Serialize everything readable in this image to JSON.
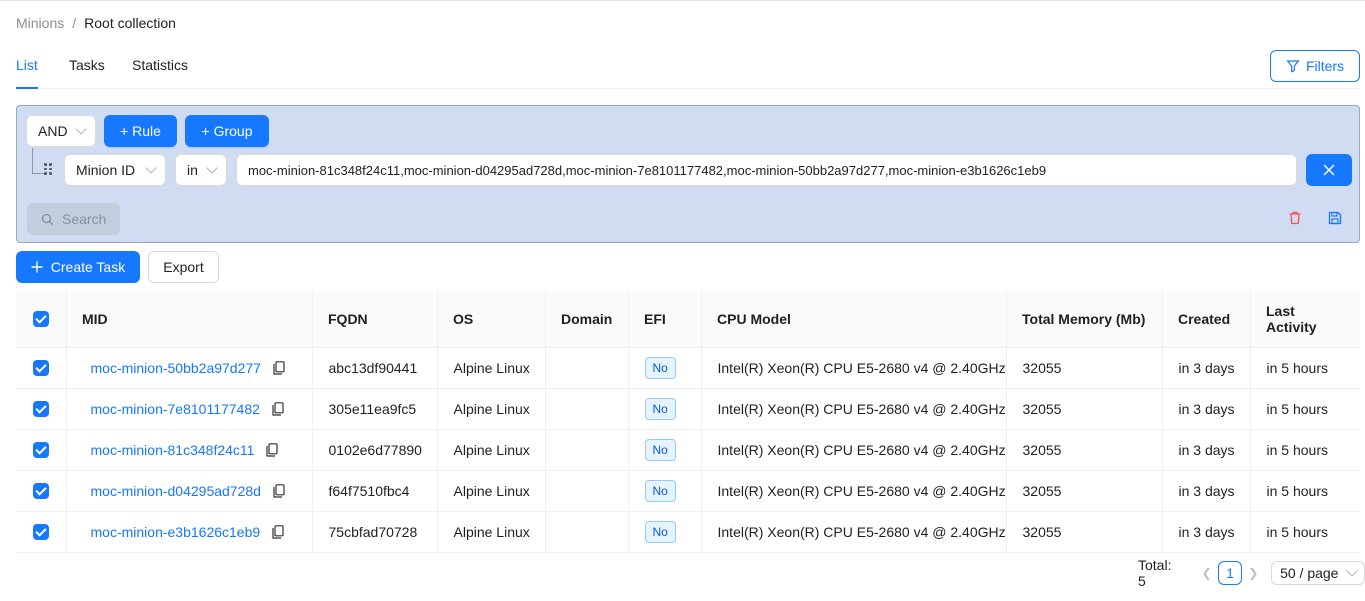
{
  "breadcrumb": {
    "parent": "Minions",
    "separator": "/",
    "current": "Root collection"
  },
  "tabs": [
    {
      "label": "List",
      "active": true
    },
    {
      "label": "Tasks",
      "active": false
    },
    {
      "label": "Statistics",
      "active": false
    }
  ],
  "filters_label": "Filters",
  "query": {
    "combinator": "AND",
    "add_rule_label": "+ Rule",
    "add_group_label": "+ Group",
    "rule": {
      "field": "Minion ID",
      "operator": "in",
      "value": "moc-minion-81c348f24c11,moc-minion-d04295ad728d,moc-minion-7e8101177482,moc-minion-50bb2a97d277,moc-minion-e3b1626c1eb9"
    },
    "search_label": "Search",
    "colors": {
      "panel_bg": "#d0dcf2",
      "delete": "#ff4d4f",
      "save": "#1677ff"
    }
  },
  "actions": {
    "create_task": "Create Task",
    "export": "Export"
  },
  "table": {
    "columns": [
      "MID",
      "FQDN",
      "OS",
      "Domain",
      "EFI",
      "CPU Model",
      "Total Memory (Mb)",
      "Created",
      "Last Activity"
    ],
    "rows": [
      {
        "mid": "moc-minion-50bb2a97d277",
        "fqdn": "abc13df90441",
        "os": "Alpine Linux",
        "domain": "",
        "efi": "No",
        "cpu": "Intel(R) Xeon(R) CPU E5-2680 v4 @ 2.40GHz",
        "memory": "32055",
        "created": "in 3 days",
        "last_activity": "in 5 hours",
        "checked": true
      },
      {
        "mid": "moc-minion-7e8101177482",
        "fqdn": "305e11ea9fc5",
        "os": "Alpine Linux",
        "domain": "",
        "efi": "No",
        "cpu": "Intel(R) Xeon(R) CPU E5-2680 v4 @ 2.40GHz",
        "memory": "32055",
        "created": "in 3 days",
        "last_activity": "in 5 hours",
        "checked": true
      },
      {
        "mid": "moc-minion-81c348f24c11",
        "fqdn": "0102e6d77890",
        "os": "Alpine Linux",
        "domain": "",
        "efi": "No",
        "cpu": "Intel(R) Xeon(R) CPU E5-2680 v4 @ 2.40GHz",
        "memory": "32055",
        "created": "in 3 days",
        "last_activity": "in 5 hours",
        "checked": true
      },
      {
        "mid": "moc-minion-d04295ad728d",
        "fqdn": "f64f7510fbc4",
        "os": "Alpine Linux",
        "domain": "",
        "efi": "No",
        "cpu": "Intel(R) Xeon(R) CPU E5-2680 v4 @ 2.40GHz",
        "memory": "32055",
        "created": "in 3 days",
        "last_activity": "in 5 hours",
        "checked": true
      },
      {
        "mid": "moc-minion-e3b1626c1eb9",
        "fqdn": "75cbfad70728",
        "os": "Alpine Linux",
        "domain": "",
        "efi": "No",
        "cpu": "Intel(R) Xeon(R) CPU E5-2680 v4 @ 2.40GHz",
        "memory": "32055",
        "created": "in 3 days",
        "last_activity": "in 5 hours",
        "checked": true
      }
    ]
  },
  "pagination": {
    "total": "Total: 5",
    "current_page": "1",
    "page_size": "50 / page"
  },
  "accent": "#1677ff"
}
